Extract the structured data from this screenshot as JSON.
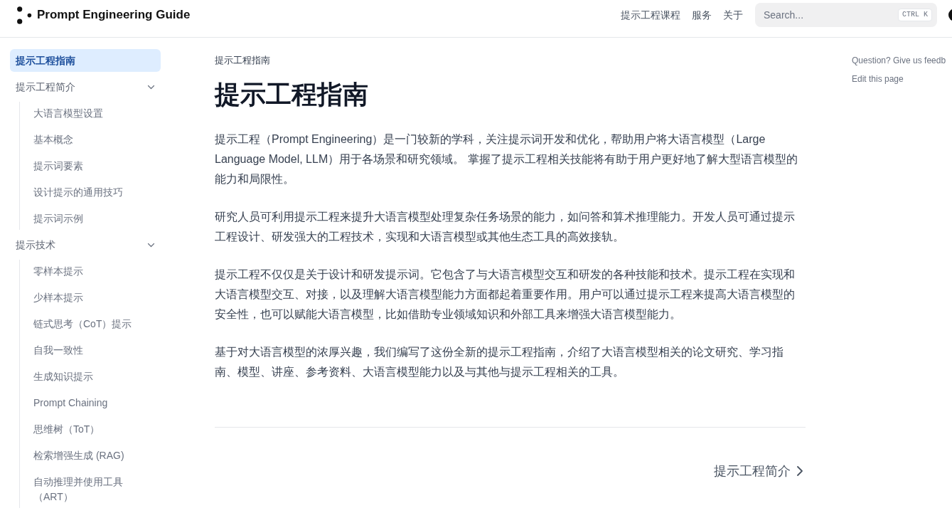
{
  "header": {
    "logo_text": "Prompt Engineering Guide",
    "nav_links": [
      "提示工程课程",
      "服务",
      "关于"
    ],
    "search": {
      "placeholder": "Search...",
      "shortcut": "CTRL K"
    }
  },
  "sidebar": {
    "items": [
      {
        "label": "提示工程指南",
        "selected": true
      },
      {
        "label": "提示工程简介",
        "selected": false,
        "expanded": true,
        "children": [
          {
            "label": "大语言模型设置",
            "selected": false
          },
          {
            "label": "基本概念",
            "selected": false
          },
          {
            "label": "提示词要素",
            "selected": false
          },
          {
            "label": "设计提示的通用技巧",
            "selected": false
          },
          {
            "label": "提示词示例",
            "selected": false
          }
        ]
      },
      {
        "label": "提示技术",
        "selected": false,
        "expanded": true,
        "children": [
          {
            "label": "零样本提示",
            "selected": false
          },
          {
            "label": "少样本提示",
            "selected": false
          },
          {
            "label": "链式思考（CoT）提示",
            "selected": false
          },
          {
            "label": "自我一致性",
            "selected": false
          },
          {
            "label": "生成知识提示",
            "selected": false
          },
          {
            "label": "Prompt Chaining",
            "selected": false
          },
          {
            "label": "思维树（ToT）",
            "selected": false
          },
          {
            "label": "检索增强生成 (RAG)",
            "selected": false
          },
          {
            "label": "自动推理并使用工具（ART）",
            "selected": false
          }
        ]
      }
    ]
  },
  "main": {
    "breadcrumb": "提示工程指南",
    "title": "提示工程指南",
    "paragraphs": [
      "提示工程（Prompt Engineering）是一门较新的学科，关注提示词开发和优化，帮助用户将大语言模型（Large Language Model, LLM）用于各场景和研究领域。 掌握了提示工程相关技能将有助于用户更好地了解大型语言模型的能力和局限性。",
      "研究人员可利用提示工程来提升大语言模型处理复杂任务场景的能力，如问答和算术推理能力。开发人员可通过提示工程设计、研发强大的工程技术，实现和大语言模型或其他生态工具的高效接轨。",
      "提示工程不仅仅是关于设计和研发提示词。它包含了与大语言模型交互和研发的各种技能和技术。提示工程在实现和大语言模型交互、对接，以及理解大语言模型能力方面都起着重要作用。用户可以通过提示工程来提高大语言模型的安全性，也可以赋能大语言模型，比如借助专业领域知识和外部工具来增强大语言模型能力。",
      "基于对大语言模型的浓厚兴趣，我们编写了这份全新的提示工程指南，介绍了大语言模型相关的论文研究、学习指南、模型、讲座、参考资料、大语言模型能力以及与其他与提示工程相关的工具。"
    ],
    "next_link": "提示工程简介"
  },
  "toc_links": [
    "Question? Give us feedb",
    "Edit this page"
  ]
}
